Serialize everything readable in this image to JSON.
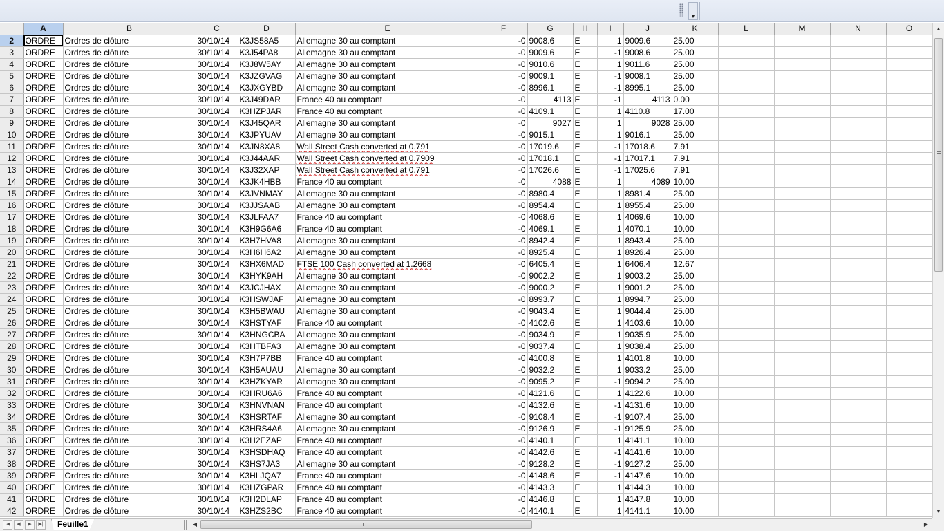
{
  "sheet": {
    "tab_name": "Feuille1",
    "columns": [
      "A",
      "B",
      "C",
      "D",
      "E",
      "F",
      "G",
      "H",
      "I",
      "J",
      "K",
      "L",
      "M",
      "N",
      "O"
    ],
    "selected_column": "A",
    "selected_row": 2,
    "rows": [
      {
        "n": "2",
        "a": "ORDRE",
        "b": "Ordres de clôture",
        "c": "30/10/14",
        "d": "K3JS58A5",
        "e": "Allemagne 30 au comptant",
        "f": "-0",
        "g": "9008.6",
        "h": "E",
        "i": "1",
        "j": "9009.6",
        "k": "25.00"
      },
      {
        "n": "3",
        "a": "ORDRE",
        "b": "Ordres de clôture",
        "c": "30/10/14",
        "d": "K3J54PA8",
        "e": "Allemagne 30 au comptant",
        "f": "-0",
        "g": "9009.6",
        "h": "E",
        "i": "-1",
        "j": "9008.6",
        "k": "25.00"
      },
      {
        "n": "4",
        "a": "ORDRE",
        "b": "Ordres de clôture",
        "c": "30/10/14",
        "d": "K3J8W5AY",
        "e": "Allemagne 30 au comptant",
        "f": "-0",
        "g": "9010.6",
        "h": "E",
        "i": "1",
        "j": "9011.6",
        "k": "25.00"
      },
      {
        "n": "5",
        "a": "ORDRE",
        "b": "Ordres de clôture",
        "c": "30/10/14",
        "d": "K3JZGVAG",
        "e": "Allemagne 30 au comptant",
        "f": "-0",
        "g": "9009.1",
        "h": "E",
        "i": "-1",
        "j": "9008.1",
        "k": "25.00"
      },
      {
        "n": "6",
        "a": "ORDRE",
        "b": "Ordres de clôture",
        "c": "30/10/14",
        "d": "K3JXGYBD",
        "e": "Allemagne 30 au comptant",
        "f": "-0",
        "g": "8996.1",
        "h": "E",
        "i": "-1",
        "j": "8995.1",
        "k": "25.00"
      },
      {
        "n": "7",
        "a": "ORDRE",
        "b": "Ordres de clôture",
        "c": "30/10/14",
        "d": "K3J49DAR",
        "e": "France 40 au comptant",
        "f": "-0",
        "g": "4113",
        "h": "E",
        "i": "-1",
        "j": "4113",
        "k": "0.00",
        "gr": true,
        "jr": true
      },
      {
        "n": "8",
        "a": "ORDRE",
        "b": "Ordres de clôture",
        "c": "30/10/14",
        "d": "K3HZPJAR",
        "e": "France 40 au comptant",
        "f": "-0",
        "g": "4109.1",
        "h": "E",
        "i": "1",
        "j": "4110.8",
        "k": "17.00"
      },
      {
        "n": "9",
        "a": "ORDRE",
        "b": "Ordres de clôture",
        "c": "30/10/14",
        "d": "K3J45QAR",
        "e": "Allemagne 30 au comptant",
        "f": "-0",
        "g": "9027",
        "h": "E",
        "i": "1",
        "j": "9028",
        "k": "25.00",
        "gr": true,
        "jr": true
      },
      {
        "n": "10",
        "a": "ORDRE",
        "b": "Ordres de clôture",
        "c": "30/10/14",
        "d": "K3JPYUAV",
        "e": "Allemagne 30 au comptant",
        "f": "-0",
        "g": "9015.1",
        "h": "E",
        "i": "1",
        "j": "9016.1",
        "k": "25.00"
      },
      {
        "n": "11",
        "a": "ORDRE",
        "b": "Ordres de clôture",
        "c": "30/10/14",
        "d": "K3JN8XA8",
        "e": "Wall Street Cash converted at 0.791",
        "f": "-0",
        "g": "17019.6",
        "h": "E",
        "i": "-1",
        "j": "17018.6",
        "k": "7.91",
        "w": true
      },
      {
        "n": "12",
        "a": "ORDRE",
        "b": "Ordres de clôture",
        "c": "30/10/14",
        "d": "K3J44AAR",
        "e": "Wall Street Cash converted at 0.7909",
        "f": "-0",
        "g": "17018.1",
        "h": "E",
        "i": "-1",
        "j": "17017.1",
        "k": "7.91",
        "w": true
      },
      {
        "n": "13",
        "a": "ORDRE",
        "b": "Ordres de clôture",
        "c": "30/10/14",
        "d": "K3J32XAP",
        "e": "Wall Street Cash converted at 0.791",
        "f": "-0",
        "g": "17026.6",
        "h": "E",
        "i": "-1",
        "j": "17025.6",
        "k": "7.91",
        "w": true
      },
      {
        "n": "14",
        "a": "ORDRE",
        "b": "Ordres de clôture",
        "c": "30/10/14",
        "d": "K3JK4HBB",
        "e": "France 40 au comptant",
        "f": "-0",
        "g": "4088",
        "h": "E",
        "i": "1",
        "j": "4089",
        "k": "10.00",
        "gr": true,
        "jr": true
      },
      {
        "n": "15",
        "a": "ORDRE",
        "b": "Ordres de clôture",
        "c": "30/10/14",
        "d": "K3JVNMAY",
        "e": "Allemagne 30 au comptant",
        "f": "-0",
        "g": "8980.4",
        "h": "E",
        "i": "1",
        "j": "8981.4",
        "k": "25.00"
      },
      {
        "n": "16",
        "a": "ORDRE",
        "b": "Ordres de clôture",
        "c": "30/10/14",
        "d": "K3JJSAAB",
        "e": "Allemagne 30 au comptant",
        "f": "-0",
        "g": "8954.4",
        "h": "E",
        "i": "1",
        "j": "8955.4",
        "k": "25.00"
      },
      {
        "n": "17",
        "a": "ORDRE",
        "b": "Ordres de clôture",
        "c": "30/10/14",
        "d": "K3JLFAA7",
        "e": "France 40 au comptant",
        "f": "-0",
        "g": "4068.6",
        "h": "E",
        "i": "1",
        "j": "4069.6",
        "k": "10.00"
      },
      {
        "n": "18",
        "a": "ORDRE",
        "b": "Ordres de clôture",
        "c": "30/10/14",
        "d": "K3H9G6A6",
        "e": "France 40 au comptant",
        "f": "-0",
        "g": "4069.1",
        "h": "E",
        "i": "1",
        "j": "4070.1",
        "k": "10.00"
      },
      {
        "n": "19",
        "a": "ORDRE",
        "b": "Ordres de clôture",
        "c": "30/10/14",
        "d": "K3H7HVA8",
        "e": "Allemagne 30 au comptant",
        "f": "-0",
        "g": "8942.4",
        "h": "E",
        "i": "1",
        "j": "8943.4",
        "k": "25.00"
      },
      {
        "n": "20",
        "a": "ORDRE",
        "b": "Ordres de clôture",
        "c": "30/10/14",
        "d": "K3H6H6A2",
        "e": "Allemagne 30 au comptant",
        "f": "-0",
        "g": "8925.4",
        "h": "E",
        "i": "1",
        "j": "8926.4",
        "k": "25.00"
      },
      {
        "n": "21",
        "a": "ORDRE",
        "b": "Ordres de clôture",
        "c": "30/10/14",
        "d": "K3HX6MAD",
        "e": "FTSE 100 Cash converted at 1.2668",
        "f": "-0",
        "g": "6405.4",
        "h": "E",
        "i": "1",
        "j": "6406.4",
        "k": "12.67",
        "w": true
      },
      {
        "n": "22",
        "a": "ORDRE",
        "b": "Ordres de clôture",
        "c": "30/10/14",
        "d": "K3HYK9AH",
        "e": "Allemagne 30 au comptant",
        "f": "-0",
        "g": "9002.2",
        "h": "E",
        "i": "1",
        "j": "9003.2",
        "k": "25.00"
      },
      {
        "n": "23",
        "a": "ORDRE",
        "b": "Ordres de clôture",
        "c": "30/10/14",
        "d": "K3JCJHAX",
        "e": "Allemagne 30 au comptant",
        "f": "-0",
        "g": "9000.2",
        "h": "E",
        "i": "1",
        "j": "9001.2",
        "k": "25.00"
      },
      {
        "n": "24",
        "a": "ORDRE",
        "b": "Ordres de clôture",
        "c": "30/10/14",
        "d": "K3HSWJAF",
        "e": "Allemagne 30 au comptant",
        "f": "-0",
        "g": "8993.7",
        "h": "E",
        "i": "1",
        "j": "8994.7",
        "k": "25.00"
      },
      {
        "n": "25",
        "a": "ORDRE",
        "b": "Ordres de clôture",
        "c": "30/10/14",
        "d": "K3H5BWAU",
        "e": "Allemagne 30 au comptant",
        "f": "-0",
        "g": "9043.4",
        "h": "E",
        "i": "1",
        "j": "9044.4",
        "k": "25.00"
      },
      {
        "n": "26",
        "a": "ORDRE",
        "b": "Ordres de clôture",
        "c": "30/10/14",
        "d": "K3HSTYAF",
        "e": "France 40 au comptant",
        "f": "-0",
        "g": "4102.6",
        "h": "E",
        "i": "1",
        "j": "4103.6",
        "k": "10.00"
      },
      {
        "n": "27",
        "a": "ORDRE",
        "b": "Ordres de clôture",
        "c": "30/10/14",
        "d": "K3HNGCBA",
        "e": "Allemagne 30 au comptant",
        "f": "-0",
        "g": "9034.9",
        "h": "E",
        "i": "1",
        "j": "9035.9",
        "k": "25.00"
      },
      {
        "n": "28",
        "a": "ORDRE",
        "b": "Ordres de clôture",
        "c": "30/10/14",
        "d": "K3HTBFA3",
        "e": "Allemagne 30 au comptant",
        "f": "-0",
        "g": "9037.4",
        "h": "E",
        "i": "1",
        "j": "9038.4",
        "k": "25.00"
      },
      {
        "n": "29",
        "a": "ORDRE",
        "b": "Ordres de clôture",
        "c": "30/10/14",
        "d": "K3H7P7BB",
        "e": "France 40 au comptant",
        "f": "-0",
        "g": "4100.8",
        "h": "E",
        "i": "1",
        "j": "4101.8",
        "k": "10.00"
      },
      {
        "n": "30",
        "a": "ORDRE",
        "b": "Ordres de clôture",
        "c": "30/10/14",
        "d": "K3H5AUAU",
        "e": "Allemagne 30 au comptant",
        "f": "-0",
        "g": "9032.2",
        "h": "E",
        "i": "1",
        "j": "9033.2",
        "k": "25.00"
      },
      {
        "n": "31",
        "a": "ORDRE",
        "b": "Ordres de clôture",
        "c": "30/10/14",
        "d": "K3HZKYAR",
        "e": "Allemagne 30 au comptant",
        "f": "-0",
        "g": "9095.2",
        "h": "E",
        "i": "-1",
        "j": "9094.2",
        "k": "25.00"
      },
      {
        "n": "32",
        "a": "ORDRE",
        "b": "Ordres de clôture",
        "c": "30/10/14",
        "d": "K3HRU6A6",
        "e": "France 40 au comptant",
        "f": "-0",
        "g": "4121.6",
        "h": "E",
        "i": "1",
        "j": "4122.6",
        "k": "10.00"
      },
      {
        "n": "33",
        "a": "ORDRE",
        "b": "Ordres de clôture",
        "c": "30/10/14",
        "d": "K3HNVNAN",
        "e": "France 40 au comptant",
        "f": "-0",
        "g": "4132.6",
        "h": "E",
        "i": "-1",
        "j": "4131.6",
        "k": "10.00"
      },
      {
        "n": "34",
        "a": "ORDRE",
        "b": "Ordres de clôture",
        "c": "30/10/14",
        "d": "K3HSRTAF",
        "e": "Allemagne 30 au comptant",
        "f": "-0",
        "g": "9108.4",
        "h": "E",
        "i": "-1",
        "j": "9107.4",
        "k": "25.00"
      },
      {
        "n": "35",
        "a": "ORDRE",
        "b": "Ordres de clôture",
        "c": "30/10/14",
        "d": "K3HRS4A6",
        "e": "Allemagne 30 au comptant",
        "f": "-0",
        "g": "9126.9",
        "h": "E",
        "i": "-1",
        "j": "9125.9",
        "k": "25.00"
      },
      {
        "n": "36",
        "a": "ORDRE",
        "b": "Ordres de clôture",
        "c": "30/10/14",
        "d": "K3H2EZAP",
        "e": "France 40 au comptant",
        "f": "-0",
        "g": "4140.1",
        "h": "E",
        "i": "1",
        "j": "4141.1",
        "k": "10.00"
      },
      {
        "n": "37",
        "a": "ORDRE",
        "b": "Ordres de clôture",
        "c": "30/10/14",
        "d": "K3HSDHAQ",
        "e": "France 40 au comptant",
        "f": "-0",
        "g": "4142.6",
        "h": "E",
        "i": "-1",
        "j": "4141.6",
        "k": "10.00"
      },
      {
        "n": "38",
        "a": "ORDRE",
        "b": "Ordres de clôture",
        "c": "30/10/14",
        "d": "K3HS7JA3",
        "e": "Allemagne 30 au comptant",
        "f": "-0",
        "g": "9128.2",
        "h": "E",
        "i": "-1",
        "j": "9127.2",
        "k": "25.00"
      },
      {
        "n": "39",
        "a": "ORDRE",
        "b": "Ordres de clôture",
        "c": "30/10/14",
        "d": "K3HLJQA7",
        "e": "France 40 au comptant",
        "f": "-0",
        "g": "4148.6",
        "h": "E",
        "i": "-1",
        "j": "4147.6",
        "k": "10.00"
      },
      {
        "n": "40",
        "a": "ORDRE",
        "b": "Ordres de clôture",
        "c": "30/10/14",
        "d": "K3HZGPAR",
        "e": "France 40 au comptant",
        "f": "-0",
        "g": "4143.3",
        "h": "E",
        "i": "1",
        "j": "4144.3",
        "k": "10.00"
      },
      {
        "n": "41",
        "a": "ORDRE",
        "b": "Ordres de clôture",
        "c": "30/10/14",
        "d": "K3H2DLAP",
        "e": "France 40 au comptant",
        "f": "-0",
        "g": "4146.8",
        "h": "E",
        "i": "1",
        "j": "4147.8",
        "k": "10.00"
      },
      {
        "n": "42",
        "a": "ORDRE",
        "b": "Ordres de clôture",
        "c": "30/10/14",
        "d": "K3HZS2BC",
        "e": "France 40 au comptant",
        "f": "-0",
        "g": "4140.1",
        "h": "E",
        "i": "1",
        "j": "4141.1",
        "k": "10.00"
      }
    ]
  },
  "colors": {
    "selection_header": "#b9d0ee",
    "grid_line": "#c6c6c6",
    "header_bg": "#ececec",
    "spell_error": "#d02020"
  },
  "icons": {
    "toolbar_dropdown": "chevron-down-icon",
    "first_sheet": "first-icon",
    "prev_sheet": "prev-icon",
    "next_sheet": "next-icon",
    "last_sheet": "last-icon",
    "scroll_left": "arrow-left-icon",
    "scroll_right": "arrow-right-icon",
    "scroll_up": "arrow-up-icon",
    "scroll_down": "arrow-down-icon"
  }
}
